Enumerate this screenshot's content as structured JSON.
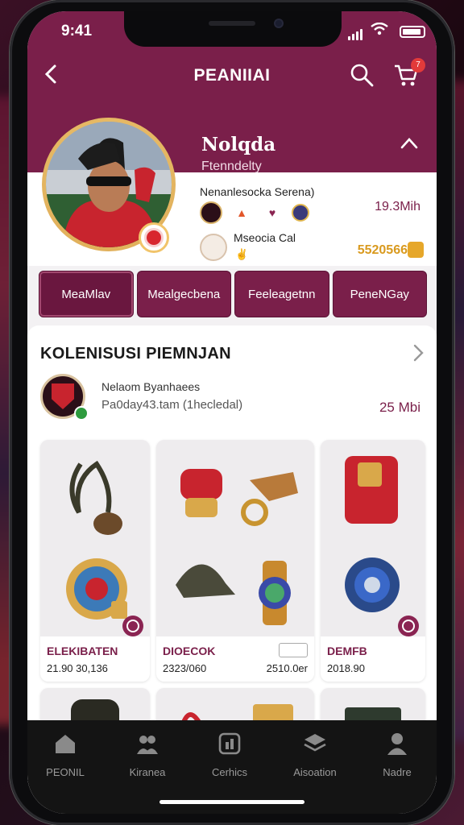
{
  "status": {
    "time": "9:41"
  },
  "appbar": {
    "title": "PEANIIAI",
    "cart_count": "7"
  },
  "profile": {
    "name": "Nolqda",
    "subtitle": "Ftenndelty",
    "row1_label": "Nenanlesocka Serena)",
    "row1_value": "19.3Mih",
    "row2_label": "Mseocia Cal",
    "row2_value": "5520566"
  },
  "tabs": [
    {
      "label": "MeaMlav"
    },
    {
      "label": "Mealgecbena"
    },
    {
      "label": "Feeleagetnn"
    },
    {
      "label": "PeneNGay"
    }
  ],
  "collection": {
    "title": "KOLENISUSI PIEMNJAN",
    "club_name": "Nelaom Byanhaees",
    "club_sub": "Pa0day43.tam (1hecledal)",
    "club_value": "25 Mbi",
    "cards": [
      {
        "title": "ELEKIBATEN",
        "price": "21.90 30,136"
      },
      {
        "title": "DIOECOK",
        "price": "2323/060",
        "price2": "2510.0er"
      },
      {
        "title": "DEMFB",
        "price": "2018.90"
      }
    ]
  },
  "nav": [
    {
      "label": "PEONIL"
    },
    {
      "label": "Kiranea"
    },
    {
      "label": "Cerhics"
    },
    {
      "label": "Aisoation"
    },
    {
      "label": "Nadre"
    }
  ],
  "colors": {
    "brand": "#7a1f4a",
    "accent_gold": "#d99a1f",
    "badge_red": "#e23a3a"
  }
}
